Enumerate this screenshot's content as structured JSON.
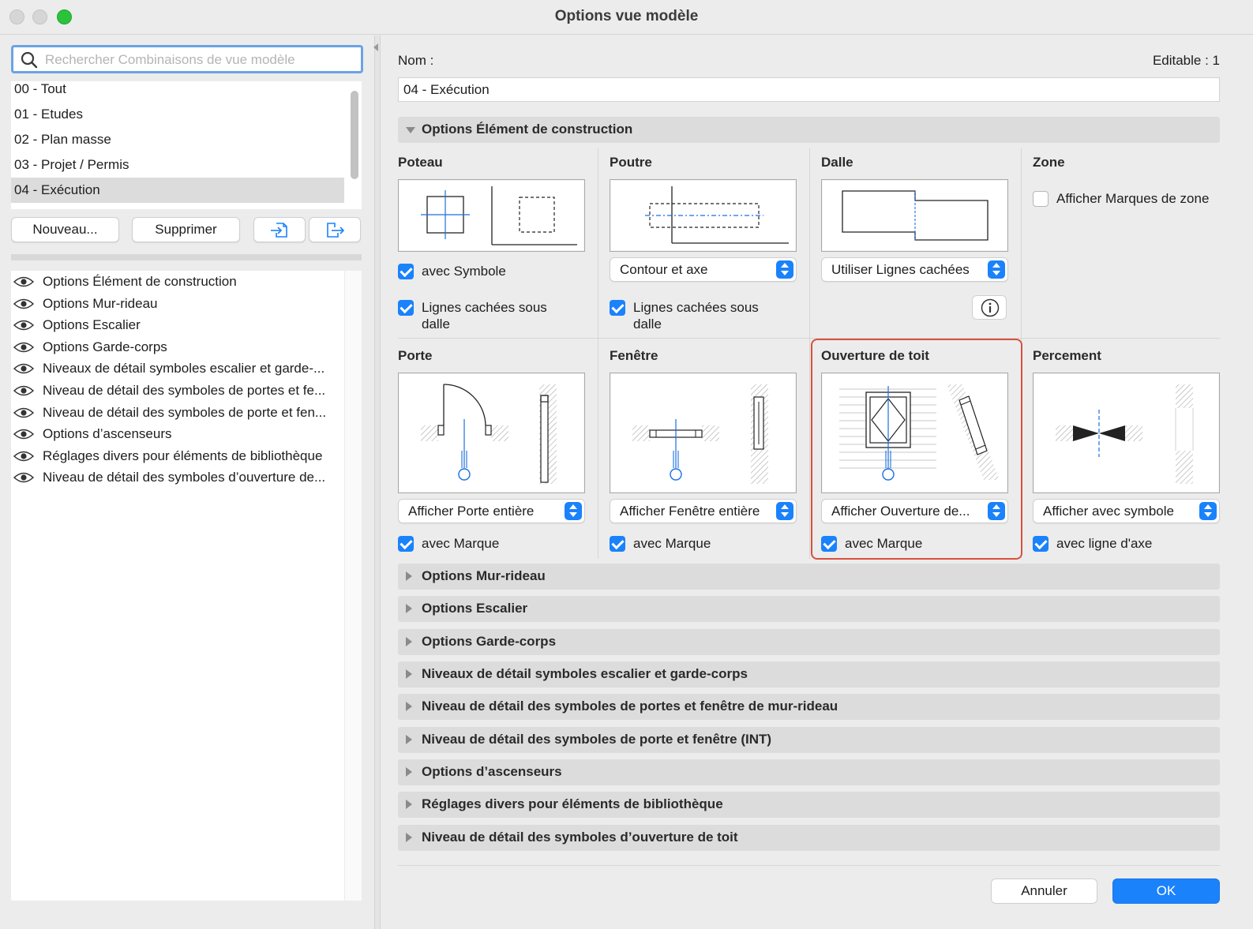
{
  "window": {
    "title": "Options vue modèle"
  },
  "left": {
    "search_placeholder": "Rechercher Combinaisons de vue modèle",
    "combinations": [
      "00 - Tout",
      "01 - Etudes",
      "02 - Plan masse",
      "03 - Projet / Permis",
      "04 - Exécution"
    ],
    "selected_index": 4,
    "new_label": "Nouveau...",
    "delete_label": "Supprimer",
    "visibility_items": [
      "Options Élément de construction",
      "Options Mur-rideau",
      "Options Escalier",
      "Options Garde-corps",
      "Niveaux de détail symboles escalier et garde-...",
      "Niveau de détail des symboles de portes et fe...",
      "Niveau de détail des symboles de porte et fen...",
      "Options d’ascenseurs",
      "Réglages divers pour éléments de bibliothèque",
      "Niveau de détail des symboles d’ouverture de..."
    ]
  },
  "right": {
    "name_label": "Nom :",
    "editable_label": "Editable : 1",
    "name_value": "04 - Exécution",
    "expanded_section": "Options Élément de construction",
    "poteau": {
      "title": "Poteau",
      "check1": "avec Symbole",
      "check1_on": true,
      "check2_line1": "Lignes cachées sous",
      "check2_line2": "dalle",
      "check2_on": true
    },
    "poutre": {
      "title": "Poutre",
      "popup": "Contour et axe",
      "check_line1": "Lignes cachées sous",
      "check_line2": "dalle",
      "check_on": true
    },
    "dalle": {
      "title": "Dalle",
      "popup": "Utiliser Lignes cachées"
    },
    "zone": {
      "title": "Zone",
      "check": "Afficher Marques de zone",
      "check_on": false
    },
    "porte": {
      "title": "Porte",
      "popup": "Afficher Porte entière",
      "check": "avec Marque",
      "check_on": true
    },
    "fenetre": {
      "title": "Fenêtre",
      "popup": "Afficher Fenêtre entière",
      "check": "avec Marque",
      "check_on": true
    },
    "ouverture": {
      "title": "Ouverture de toit",
      "popup": "Afficher Ouverture de...",
      "check": "avec Marque",
      "check_on": true
    },
    "percement": {
      "title": "Percement",
      "popup": "Afficher avec symbole",
      "check": "avec ligne d'axe",
      "check_on": true
    },
    "collapsed_sections": [
      "Options Mur-rideau",
      "Options Escalier",
      "Options Garde-corps",
      "Niveaux de détail symboles escalier et garde-corps",
      "Niveau de détail des symboles de portes et fenêtre de mur-rideau",
      "Niveau de détail des symboles de porte et fenêtre (INT)",
      "Options d’ascenseurs",
      "Réglages divers pour éléments de bibliothèque",
      "Niveau de détail des symboles d’ouverture de toit"
    ],
    "cancel_label": "Annuler",
    "ok_label": "OK"
  },
  "colors": {
    "accent": "#1a82fb",
    "highlight": "#d9503e"
  }
}
